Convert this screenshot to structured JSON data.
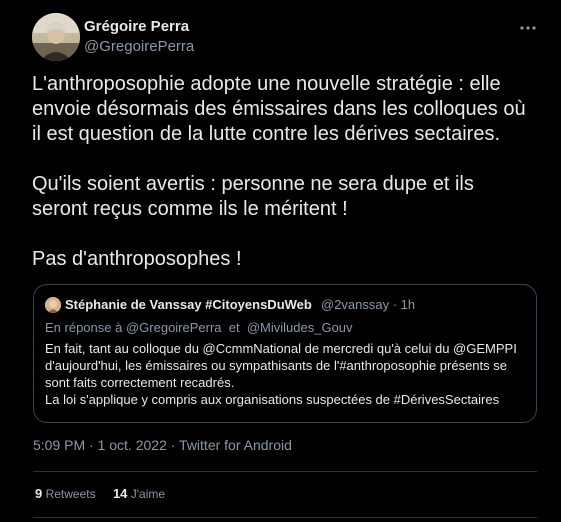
{
  "author": {
    "name": "Grégoire Perra",
    "handle": "@GregoirePerra"
  },
  "tweet": {
    "paragraphs": [
      "L'anthroposophie adopte une nouvelle stratégie : elle envoie désormais des émissaires dans les colloques où il est question de la lutte contre les dérives sectaires.",
      "Qu'ils soient avertis : personne ne sera dupe et ils seront reçus comme ils le méritent !",
      "Pas d'anthroposophes !"
    ]
  },
  "quote": {
    "name": "Stéphanie de Vanssay #CitoyensDuWeb",
    "handle_time": "@2vanssay · 1h",
    "reply_prefix": "En réponse à",
    "reply_user1": "@GregoirePerra",
    "reply_and": "et",
    "reply_user2": "@Miviludes_Gouv",
    "body_paragraphs": [
      "En fait, tant au colloque du @CcmmNational de mercredi qu'à celui du @GEMPPI d'aujourd'hui, les émissaires ou sympathisants de l'#anthroposophie présents se sont faits correctement recadrés.",
      "La loi s'applique y compris aux organisations suspectées de #DérivesSectaires"
    ]
  },
  "meta": {
    "timestamp": "5:09 PM · 1 oct. 2022 · Twitter for Android"
  },
  "stats": {
    "retweets_count": "9",
    "retweets_label": "Retweets",
    "likes_count": "14",
    "likes_label": "J'aime"
  },
  "icons": {
    "more": "more-horizontal-icon"
  },
  "colors": {
    "background": "#000000",
    "text": "#e7e9ea",
    "secondary": "#8b98a5",
    "border": "#38444d"
  }
}
